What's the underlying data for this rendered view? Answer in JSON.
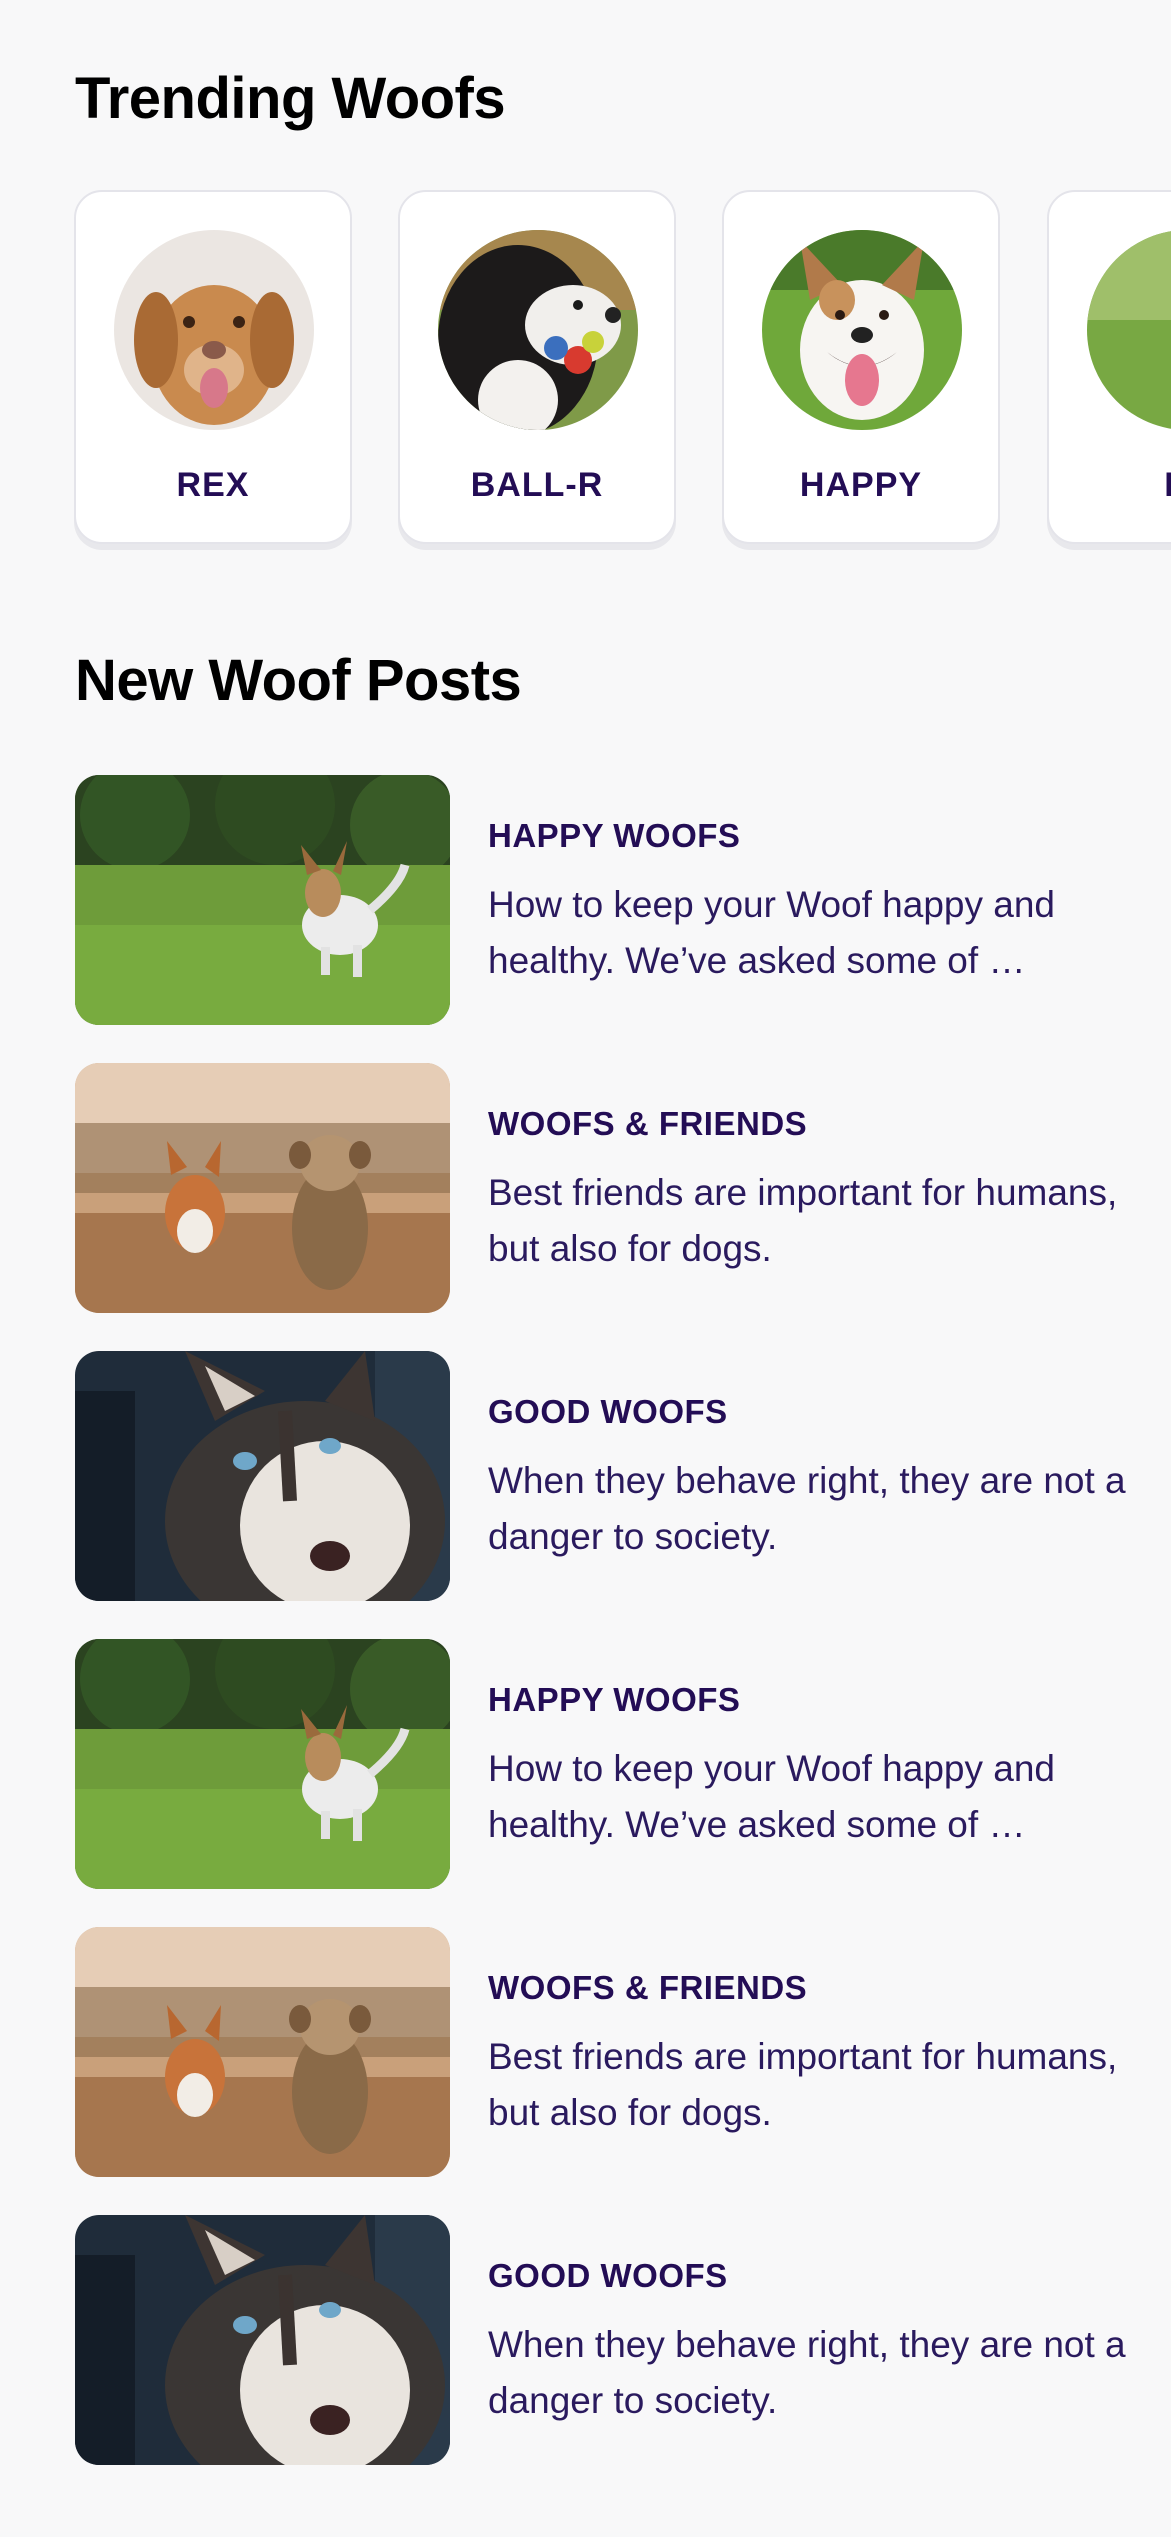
{
  "trending": {
    "title": "Trending Woofs",
    "items": [
      {
        "name": "REX",
        "avatar_icon": "dog-rex-photo"
      },
      {
        "name": "BALL-R",
        "avatar_icon": "dog-ball-photo"
      },
      {
        "name": "HAPPY",
        "avatar_icon": "dog-happy-photo"
      },
      {
        "name": "FL",
        "avatar_icon": "dog-fluffy-photo"
      }
    ]
  },
  "posts": {
    "title": "New Woof Posts",
    "items": [
      {
        "category": "HAPPY WOOFS",
        "excerpt": "How to keep your Woof happy and healthy. We’ve asked some of …",
        "image_icon": "jumping-dog-photo"
      },
      {
        "category": "WOOFS & FRIENDS",
        "excerpt": "Best friends are important for humans, but also for dogs.",
        "image_icon": "two-dogs-photo"
      },
      {
        "category": "GOOD WOOFS",
        "excerpt": "When they behave right, they are not a danger to society.",
        "image_icon": "husky-photo"
      },
      {
        "category": "HAPPY WOOFS",
        "excerpt": "How to keep your Woof happy and healthy. We’ve asked some of …",
        "image_icon": "jumping-dog-photo"
      },
      {
        "category": "WOOFS & FRIENDS",
        "excerpt": "Best friends are important for humans, but also for dogs.",
        "image_icon": "two-dogs-photo"
      },
      {
        "category": "GOOD WOOFS",
        "excerpt": "When they behave right, they are not a danger to society.",
        "image_icon": "husky-photo"
      }
    ]
  },
  "colors": {
    "background": "#f8f8f9",
    "card": "#ffffff",
    "accent_text": "#230d55",
    "heading": "#000000"
  }
}
